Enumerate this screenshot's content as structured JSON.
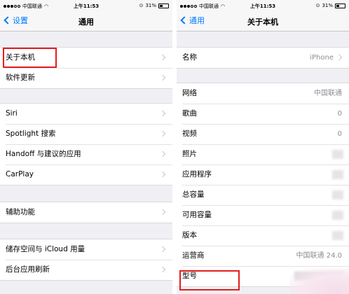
{
  "status": {
    "carrier": "中国联通",
    "time": "上午11:53",
    "battery": "31%",
    "battery_level": 0.31
  },
  "left": {
    "nav": {
      "back": "设置",
      "title": "通用"
    },
    "groups": [
      [
        "关于本机",
        "软件更新"
      ],
      [
        "Siri",
        "Spotlight 搜索",
        "Handoff 与建议的应用",
        "CarPlay"
      ],
      [
        "辅助功能"
      ],
      [
        "储存空间与 iCloud 用量",
        "后台应用刷新"
      ]
    ]
  },
  "right": {
    "nav": {
      "back": "通用",
      "title": "关于本机"
    },
    "name": {
      "label": "名称",
      "value": "iPhone"
    },
    "rows": [
      {
        "label": "网络",
        "value": "中国联通"
      },
      {
        "label": "歌曲",
        "value": "0"
      },
      {
        "label": "视频",
        "value": "0"
      },
      {
        "label": "照片",
        "value": ""
      },
      {
        "label": "应用程序",
        "value": ""
      },
      {
        "label": "总容量",
        "value": ""
      },
      {
        "label": "可用容量",
        "value": ""
      },
      {
        "label": "版本",
        "value": ""
      },
      {
        "label": "运营商",
        "value": "中国联通 24.0"
      },
      {
        "label": "型号",
        "value": ""
      }
    ]
  },
  "colors": {
    "accent": "#007aff",
    "highlight": "#e31d1d",
    "background": "#efeff4"
  }
}
